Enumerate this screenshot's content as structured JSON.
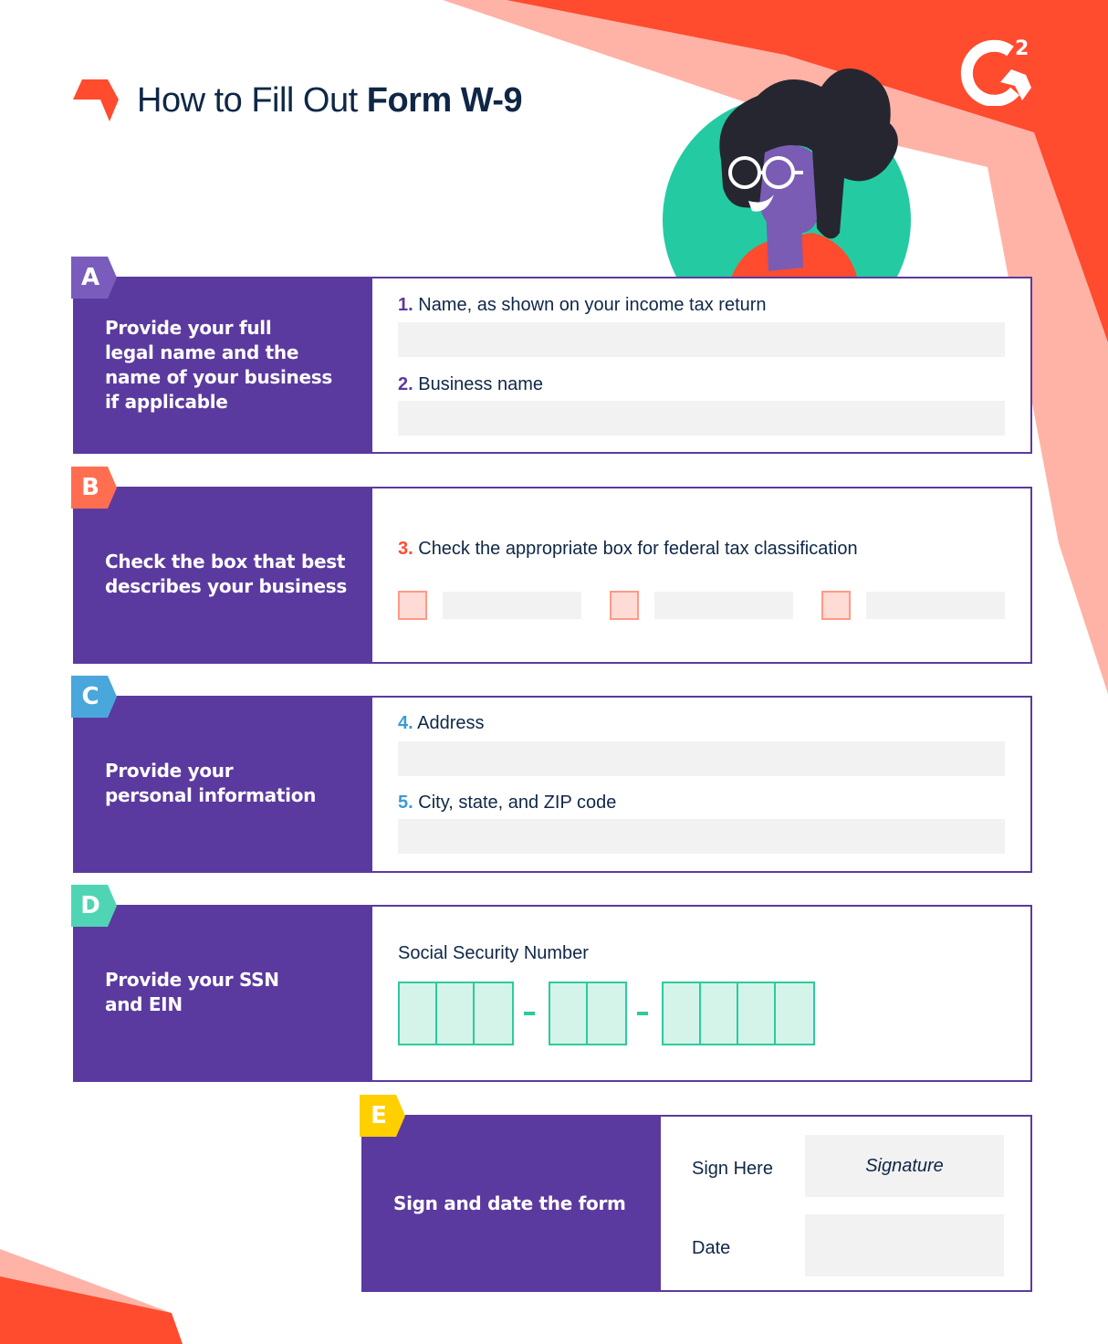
{
  "header": {
    "title_light": "How to Fill Out ",
    "title_bold": "Form W-9",
    "logo_icon": "orange-hexagon-mark",
    "brand_logo": "g2-logo",
    "brand_sup": "2"
  },
  "colors": {
    "panel": "#5b3a9f",
    "accent_orange": "#ff4b2e",
    "accent_pink": "#ffb3a6",
    "badge_a": "#7a5cbc",
    "badge_b": "#ff6e50",
    "badge_c": "#4aa7dc",
    "badge_d": "#4fd5b4",
    "badge_e": "#ffcf00",
    "ssn_green": "#2ccb9c",
    "input_gray": "#f2f2f2",
    "text_dark": "#0f2746"
  },
  "sections": {
    "a": {
      "letter": "A",
      "heading_lines": [
        "Provide your full",
        "legal name and the",
        "name of your business",
        "if applicable"
      ],
      "fields": [
        {
          "num": "1.",
          "label": " Name, as shown on your income tax return",
          "value": ""
        },
        {
          "num": "2.",
          "label": " Business name",
          "value": ""
        }
      ]
    },
    "b": {
      "letter": "B",
      "heading_lines": [
        "Check the box that best",
        "describes your business"
      ],
      "fields": [
        {
          "num": "3.",
          "label": " Check the appropriate box for federal tax classification"
        }
      ],
      "checkbox_count": 3
    },
    "c": {
      "letter": "C",
      "heading_lines": [
        "Provide your",
        "personal information"
      ],
      "fields": [
        {
          "num": "4.",
          "label": " Address",
          "value": ""
        },
        {
          "num": "5.",
          "label": " City, state, and ZIP code",
          "value": ""
        }
      ]
    },
    "d": {
      "letter": "D",
      "heading_lines": [
        "Provide your SSN",
        "and EIN"
      ],
      "ssn_label": "Social Security Number",
      "ssn_groups": [
        3,
        2,
        4
      ],
      "ssn_separator": "-"
    },
    "e": {
      "letter": "E",
      "heading": "Sign and date the form",
      "sign_label": "Sign Here",
      "sign_placeholder": "Signature",
      "date_label": "Date",
      "date_value": ""
    }
  }
}
